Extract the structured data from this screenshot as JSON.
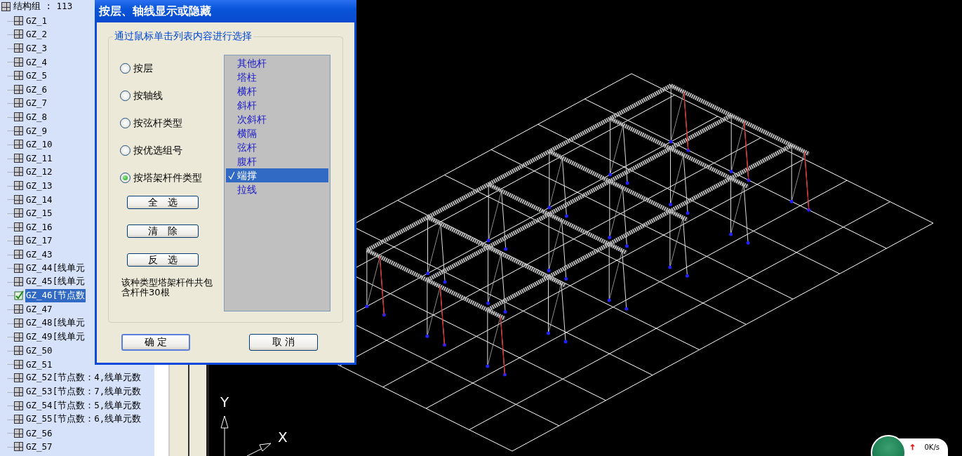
{
  "tree": {
    "header": "结构组 : 113",
    "items": [
      {
        "label": "GZ_1",
        "selected": false
      },
      {
        "label": "GZ_2",
        "selected": false
      },
      {
        "label": "GZ_3",
        "selected": false
      },
      {
        "label": "GZ_4",
        "selected": false
      },
      {
        "label": "GZ_5",
        "selected": false
      },
      {
        "label": "GZ_6",
        "selected": false
      },
      {
        "label": "GZ_7",
        "selected": false
      },
      {
        "label": "GZ_8",
        "selected": false
      },
      {
        "label": "GZ_9",
        "selected": false
      },
      {
        "label": "GZ_10",
        "selected": false
      },
      {
        "label": "GZ_11",
        "selected": false
      },
      {
        "label": "GZ_12",
        "selected": false
      },
      {
        "label": "GZ_13",
        "selected": false
      },
      {
        "label": "GZ_14",
        "selected": false
      },
      {
        "label": "GZ_15",
        "selected": false
      },
      {
        "label": "GZ_16",
        "selected": false
      },
      {
        "label": "GZ_17",
        "selected": false
      },
      {
        "label": "GZ_43",
        "selected": false
      },
      {
        "label": "GZ_44[线单元",
        "selected": false
      },
      {
        "label": "GZ_45[线单元",
        "selected": false
      },
      {
        "label": "GZ_46[节点数",
        "selected": true
      },
      {
        "label": "GZ_47",
        "selected": false
      },
      {
        "label": "GZ_48[线单元",
        "selected": false
      },
      {
        "label": "GZ_49[线单元",
        "selected": false
      },
      {
        "label": "GZ_50",
        "selected": false
      },
      {
        "label": "GZ_51",
        "selected": false
      },
      {
        "label": "GZ_52[节点数：4,线单元数",
        "selected": false
      },
      {
        "label": "GZ_53[节点数：7,线单元数",
        "selected": false
      },
      {
        "label": "GZ_54[节点数：5,线单元数",
        "selected": false
      },
      {
        "label": "GZ_55[节点数：6,线单元数",
        "selected": false
      },
      {
        "label": "GZ_56",
        "selected": false
      },
      {
        "label": "GZ_57",
        "selected": false
      }
    ]
  },
  "dialog": {
    "title": "按层、轴线显示或隐藏",
    "group_label": "通过鼠标单击列表内容进行选择",
    "radios": [
      {
        "label": "按层",
        "selected": false
      },
      {
        "label": "按轴线",
        "selected": false
      },
      {
        "label": "按弦杆类型",
        "selected": false
      },
      {
        "label": "按优选组号",
        "selected": false
      },
      {
        "label": "按塔架杆件类型",
        "selected": true
      }
    ],
    "side_buttons": [
      "全　选",
      "清　除",
      "反　选"
    ],
    "info": "该种类型塔架杆件共包含杆件30根",
    "list": [
      {
        "label": "其他杆",
        "selected": false
      },
      {
        "label": "塔柱",
        "selected": false
      },
      {
        "label": "横杆",
        "selected": false
      },
      {
        "label": "斜杆",
        "selected": false
      },
      {
        "label": "次斜杆",
        "selected": false
      },
      {
        "label": "横隔",
        "selected": false
      },
      {
        "label": "弦杆",
        "selected": false
      },
      {
        "label": "腹杆",
        "selected": false
      },
      {
        "label": "端撑",
        "selected": true
      },
      {
        "label": "拉线",
        "selected": false
      }
    ],
    "footer_buttons": [
      "确 定",
      "取 消"
    ]
  },
  "viewport": {
    "axis_y": "Y",
    "axis_x": "X",
    "network_speed": "0K/s"
  }
}
